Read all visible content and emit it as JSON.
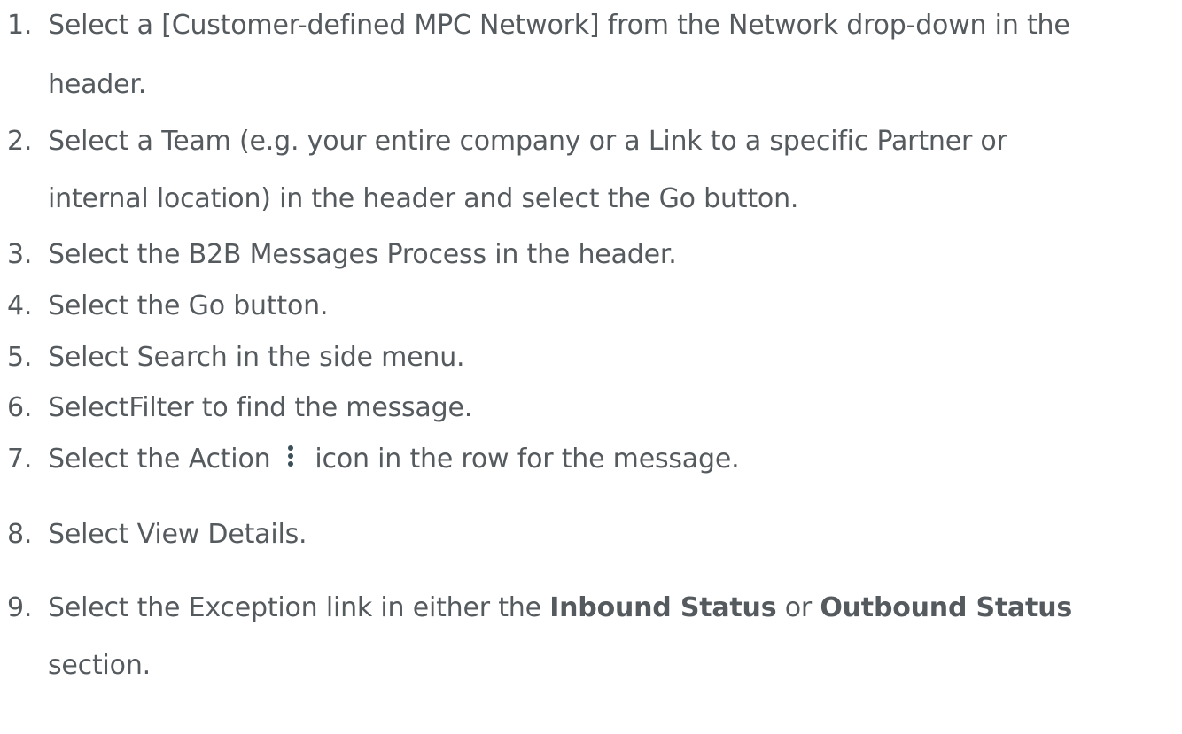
{
  "steps": [
    {
      "num": "1.",
      "line1": "Select a [Customer-defined MPC Network] from the Network drop-down in the",
      "line2": "header."
    },
    {
      "num": "2.",
      "line1": "Select a Team (e.g. your entire company or a Link to a specific Partner or",
      "line2": "internal location) in the header and select the Go button."
    },
    {
      "num": "3.",
      "text": "Select the B2B Messages Process in the header."
    },
    {
      "num": "4.",
      "text": "Select the Go button."
    },
    {
      "num": "5.",
      "text": "Select Search in the side menu."
    },
    {
      "num": "6.",
      "text": "SelectFilter to find the message."
    },
    {
      "num": "7.",
      "before_icon": "Select the Action",
      "icon": "kebab-menu-icon",
      "after_icon": "icon in the row for the message."
    },
    {
      "num": "8.",
      "text": "Select View Details."
    },
    {
      "num": "9.",
      "part1": "Select the Exception link in either the ",
      "bold1": "Inbound Status",
      "part2": " or ",
      "bold2": "Outbound Status",
      "line2": "section."
    }
  ]
}
